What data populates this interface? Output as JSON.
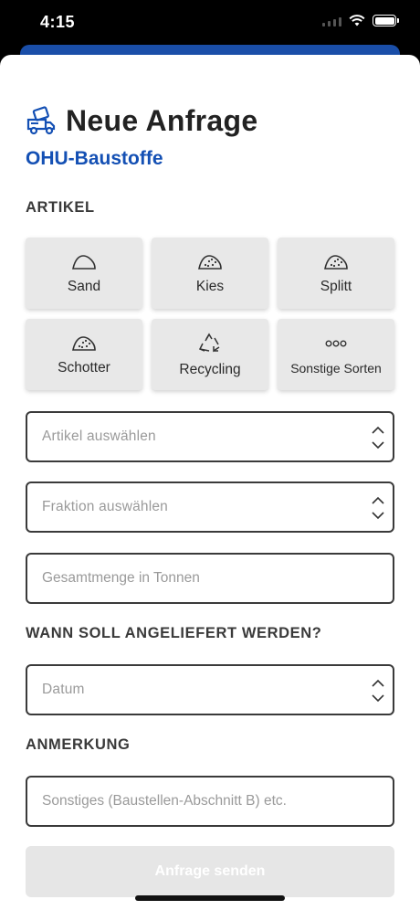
{
  "status_bar": {
    "time": "4:15"
  },
  "header": {
    "title": "Neue Anfrage",
    "brand": "OHU-Baustoffe",
    "icon": "truck-icon"
  },
  "sections": {
    "artikel": "ARTIKEL",
    "delivery": "WANN SOLL ANGELIEFERT WERDEN?",
    "notes": "ANMERKUNG"
  },
  "tiles": [
    {
      "label": "Sand",
      "icon": "sand-pile-icon"
    },
    {
      "label": "Kies",
      "icon": "gravel-pile-icon"
    },
    {
      "label": "Splitt",
      "icon": "gravel-pile-icon"
    },
    {
      "label": "Schotter",
      "icon": "gravel-pile-icon"
    },
    {
      "label": "Recycling",
      "icon": "recycle-icon"
    },
    {
      "label": "Sonstige Sorten",
      "icon": "more-icon"
    }
  ],
  "fields": {
    "artikel_select": "Artikel auswählen",
    "fraktion_select": "Fraktion auswählen",
    "menge_placeholder": "Gesamtmenge in Tonnen",
    "datum_select": "Datum",
    "anmerkung_placeholder": "Sonstiges (Baustellen-Abschnitt B) etc."
  },
  "submit_label": "Anfrage senden",
  "colors": {
    "brand": "#1450b4",
    "strip": "#1a4ea8",
    "tile_bg": "#e8e8e8",
    "disabled_button": "#e6e6e6"
  }
}
